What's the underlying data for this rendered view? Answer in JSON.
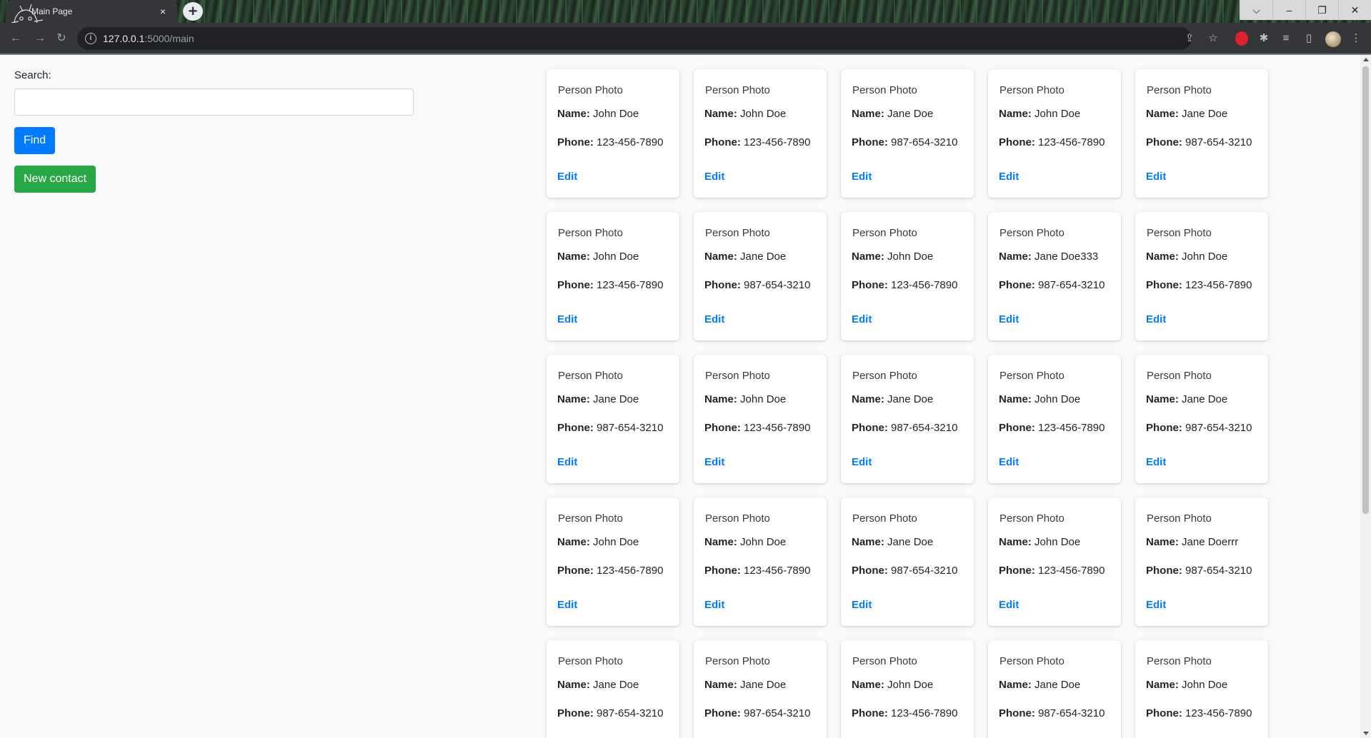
{
  "browser": {
    "tab_title": "Main Page",
    "tab_close": "×",
    "new_tab": "+",
    "url_host": "127.0.0.1",
    "url_path": ":5000/main",
    "window_controls": [
      "⌵",
      "–",
      "❐",
      "✕"
    ]
  },
  "sidebar": {
    "search_label": "Search:",
    "search_value": "",
    "find_label": "Find",
    "new_contact_label": "New contact"
  },
  "labels": {
    "photo_alt": "Person Photo",
    "name": "Name:",
    "phone": "Phone:",
    "edit": "Edit"
  },
  "contacts": [
    {
      "name": "John Doe",
      "phone": "123-456-7890"
    },
    {
      "name": "John Doe",
      "phone": "123-456-7890"
    },
    {
      "name": "Jane Doe",
      "phone": "987-654-3210"
    },
    {
      "name": "John Doe",
      "phone": "123-456-7890"
    },
    {
      "name": "Jane Doe",
      "phone": "987-654-3210"
    },
    {
      "name": "John Doe",
      "phone": "123-456-7890"
    },
    {
      "name": "Jane Doe",
      "phone": "987-654-3210"
    },
    {
      "name": "John Doe",
      "phone": "123-456-7890"
    },
    {
      "name": "Jane Doe333",
      "phone": "987-654-3210"
    },
    {
      "name": "John Doe",
      "phone": "123-456-7890"
    },
    {
      "name": "Jane Doe",
      "phone": "987-654-3210"
    },
    {
      "name": "John Doe",
      "phone": "123-456-7890"
    },
    {
      "name": "Jane Doe",
      "phone": "987-654-3210"
    },
    {
      "name": "John Doe",
      "phone": "123-456-7890"
    },
    {
      "name": "Jane Doe",
      "phone": "987-654-3210"
    },
    {
      "name": "John Doe",
      "phone": "123-456-7890"
    },
    {
      "name": "John Doe",
      "phone": "123-456-7890"
    },
    {
      "name": "Jane Doe",
      "phone": "987-654-3210"
    },
    {
      "name": "John Doe",
      "phone": "123-456-7890"
    },
    {
      "name": "Jane Doerrr",
      "phone": "987-654-3210"
    },
    {
      "name": "Jane Doe",
      "phone": "987-654-3210"
    },
    {
      "name": "Jane Doe",
      "phone": "987-654-3210"
    },
    {
      "name": "John Doe",
      "phone": "123-456-7890"
    },
    {
      "name": "Jane Doe",
      "phone": "987-654-3210"
    },
    {
      "name": "John Doe",
      "phone": "123-456-7890"
    }
  ]
}
